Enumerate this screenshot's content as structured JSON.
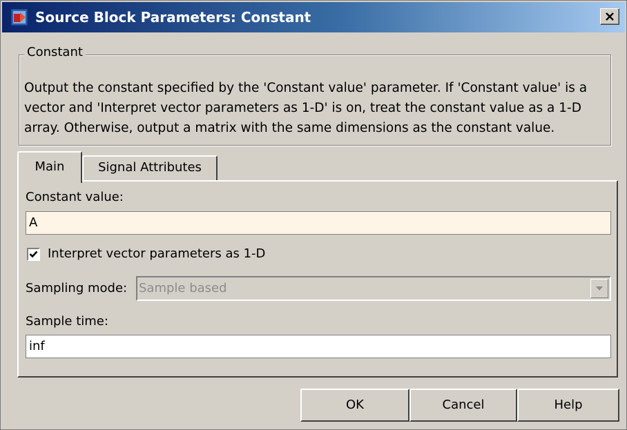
{
  "window": {
    "title": "Source Block Parameters: Constant"
  },
  "group": {
    "legend": "Constant",
    "description": "Output the constant specified by the 'Constant value' parameter. If 'Constant value' is a vector and 'Interpret vector parameters as 1-D' is on, treat the constant value as a 1-D array. Otherwise, output a matrix with the same dimensions as the constant value."
  },
  "tabs": [
    {
      "label": "Main",
      "active": true
    },
    {
      "label": "Signal Attributes",
      "active": false
    }
  ],
  "main": {
    "constant_value_label": "Constant value:",
    "constant_value": "A",
    "interpret_vector_label": "Interpret vector parameters as 1-D",
    "interpret_vector_checked": true,
    "sampling_mode_label": "Sampling mode:",
    "sampling_mode_value": "Sample based",
    "sample_time_label": "Sample time:",
    "sample_time_value": "inf"
  },
  "buttons": {
    "ok": "OK",
    "cancel": "Cancel",
    "help": "Help"
  },
  "icons": {
    "app": "simulink-block-icon",
    "close": "close-icon",
    "dropdown": "chevron-down-icon",
    "check": "checkmark-icon"
  },
  "colors": {
    "titlebar_start": "#0a246a",
    "titlebar_end": "#a6caf0",
    "highlight_field": "#fff5e6",
    "window_bg": "#d4d0c8"
  }
}
